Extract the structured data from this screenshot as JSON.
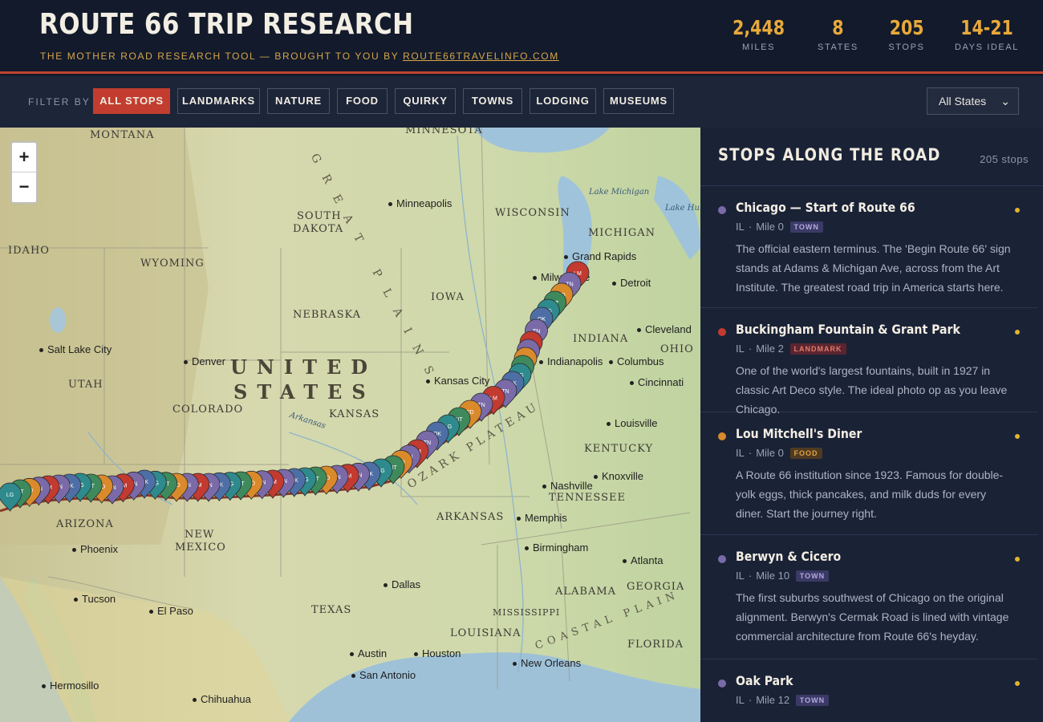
{
  "header": {
    "title": "ROUTE 66 TRIP RESEARCH",
    "subtitle_prefix": "THE MOTHER ROAD RESEARCH TOOL — BROUGHT TO YOU BY",
    "subtitle_link": "ROUTE66TRAVELINFO.COM",
    "stats": [
      {
        "value": "2,448",
        "label": "MILES"
      },
      {
        "value": "8",
        "label": "STATES"
      },
      {
        "value": "205",
        "label": "STOPS"
      },
      {
        "value": "14-21",
        "label": "DAYS IDEAL"
      }
    ]
  },
  "filters": {
    "label": "FILTER BY",
    "buttons": [
      {
        "label": "ALL STOPS",
        "active": true
      },
      {
        "label": "LANDMARKS",
        "active": false
      },
      {
        "label": "NATURE",
        "active": false
      },
      {
        "label": "FOOD",
        "active": false
      },
      {
        "label": "QUIRKY",
        "active": false
      },
      {
        "label": "TOWNS",
        "active": false
      },
      {
        "label": "LODGING",
        "active": false
      },
      {
        "label": "MUSEUMS",
        "active": false
      }
    ],
    "state_select": {
      "value": "All States",
      "icon": "chevron-down-icon"
    }
  },
  "map": {
    "zoom_in": "+",
    "zoom_out": "−",
    "country_line1": "UNITED",
    "country_line2": "STATES",
    "states": [
      "MONTANA",
      "MINNESOTA",
      "SOUTH",
      "DAKOTA",
      "WISCONSIN",
      "MICHIGAN",
      "IDAHO",
      "WYOMING",
      "IOWA",
      "NEBRASKA",
      "INDIANA",
      "OHIO",
      "UTAH",
      "COLORADO",
      "KANSAS",
      "KENTUCKY",
      "TENNESSEE",
      "ARKANSAS",
      "ARIZONA",
      "NEW",
      "MEXICO",
      "TEXAS",
      "ALABAMA",
      "GEORGIA",
      "MISSISSIPPI",
      "LOUISIANA",
      "FLORIDA"
    ],
    "cities": [
      "Minneapolis",
      "Grand Rapids",
      "Milwaukee",
      "Detroit",
      "Salt Lake City",
      "Denver",
      "Kansas City",
      "Indianapolis",
      "Columbus",
      "Cleveland",
      "Cincinnati",
      "Louisville",
      "Nashville",
      "Knoxville",
      "Memphis",
      "Birmingham",
      "Atlanta",
      "Phoenix",
      "Tucson",
      "El Paso",
      "Dallas",
      "Austin",
      "San Antonio",
      "Houston",
      "New Orleans",
      "Hermosillo",
      "Chihuahua"
    ],
    "features": [
      "Lake Michigan",
      "Lake Huron",
      "OZARK PLATEAU",
      "GREAT PLAINS",
      "COASTAL PLAIN",
      "Arkansas"
    ],
    "marker_colors": {
      "landmark": "#c23a30",
      "nature": "#3e8a5c",
      "food": "#d98a2b",
      "quirky": "#7a6aa8",
      "town": "#7a6aa8",
      "lodging": "#2e8a8c",
      "museum": "#4d6fa6"
    }
  },
  "sidebar": {
    "title": "STOPS ALONG THE ROAD",
    "count": "205 stops",
    "stops": [
      {
        "name": "Chicago — Start of Route 66",
        "state": "IL",
        "mile": "Mile 0",
        "tag": "TOWN",
        "dot_color": "#7a6aa8",
        "tag_bg": "#3b3a66",
        "tag_fg": "#b4a8e0",
        "desc": "The official eastern terminus. The 'Begin Route 66' sign stands at Adams & Michigan Ave, across from the Art Institute. The greatest road trip in America starts here."
      },
      {
        "name": "Buckingham Fountain & Grant Park",
        "state": "IL",
        "mile": "Mile 2",
        "tag": "LANDMARK",
        "dot_color": "#c23a30",
        "tag_bg": "#5a2530",
        "tag_fg": "#e07a6a",
        "desc": "One of the world's largest fountains, built in 1927 in classic Art Deco style. The ideal photo op as you leave Chicago."
      },
      {
        "name": "Lou Mitchell's Diner",
        "state": "IL",
        "mile": "Mile 0",
        "tag": "FOOD",
        "dot_color": "#d98a2b",
        "tag_bg": "#4f3a22",
        "tag_fg": "#e0a040",
        "desc": "A Route 66 institution since 1923. Famous for double-yolk eggs, thick pancakes, and milk duds for every diner. Start the journey right."
      },
      {
        "name": "Berwyn & Cicero",
        "state": "IL",
        "mile": "Mile 10",
        "tag": "TOWN",
        "dot_color": "#7a6aa8",
        "tag_bg": "#3b3a66",
        "tag_fg": "#b4a8e0",
        "desc": "The first suburbs southwest of Chicago on the original alignment. Berwyn's Cermak Road is lined with vintage commercial architecture from Route 66's heyday."
      },
      {
        "name": "Oak Park",
        "state": "IL",
        "mile": "Mile 12",
        "tag": "TOWN",
        "dot_color": "#7a6aa8",
        "tag_bg": "#3b3a66",
        "tag_fg": "#b4a8e0",
        "desc": ""
      }
    ]
  }
}
